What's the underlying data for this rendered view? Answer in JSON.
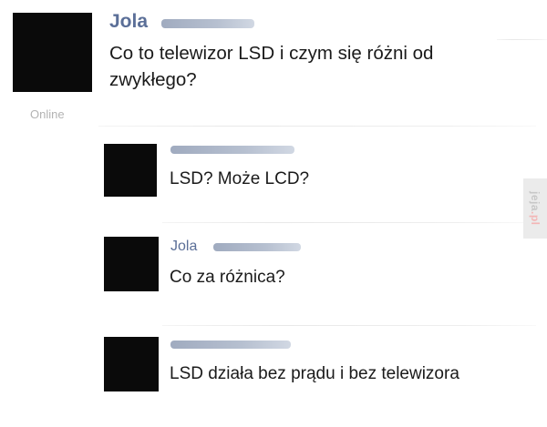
{
  "status": "Online",
  "watermark": {
    "main": "jeja",
    "tld": ".pl"
  },
  "messages": [
    {
      "author": "Jola",
      "text_line1": "Co to telewizor LSD i czym się różni od",
      "text_line2": "zwykłego?"
    },
    {
      "author": "",
      "text": "LSD? Może LCD?"
    },
    {
      "author": "Jola",
      "text": "Co za różnica?"
    },
    {
      "author": "",
      "text": "LSD działa bez prądu i bez telewizora"
    }
  ]
}
